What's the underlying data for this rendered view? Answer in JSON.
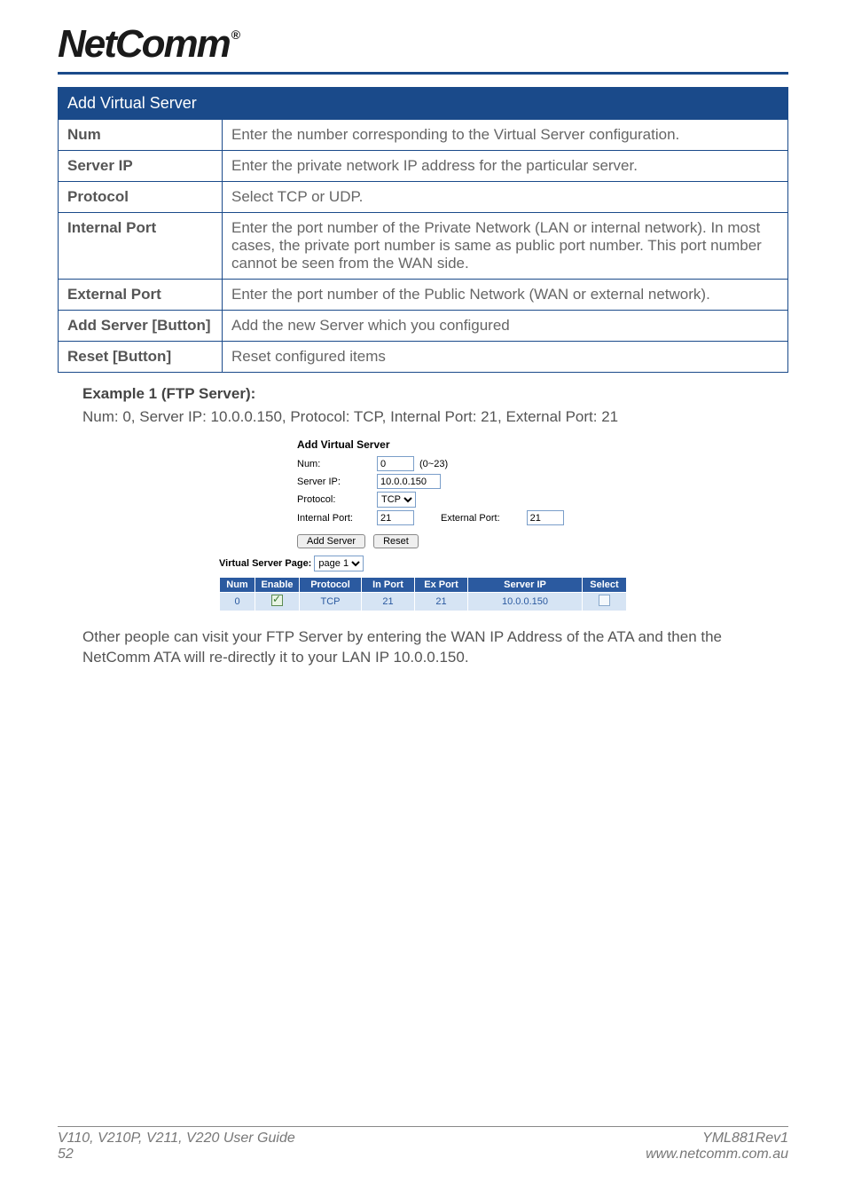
{
  "brand": "NetComm",
  "reg": "®",
  "table": {
    "title": "Add Virtual Server",
    "rows": [
      {
        "label": "Num",
        "desc": "Enter the number corresponding to the Virtual Server configuration."
      },
      {
        "label": "Server IP",
        "desc": "Enter the private network IP address for the particular server."
      },
      {
        "label": "Protocol",
        "desc": "Select TCP or UDP."
      },
      {
        "label": "Internal Port",
        "desc": "Enter the port number of the Private Network (LAN or internal network). In most cases, the private port number is same as public port number. This port number cannot be seen from the WAN side."
      },
      {
        "label": "External Port",
        "desc": "Enter the port number of the Public Network (WAN or external network)."
      },
      {
        "label": "Add Server [Button]",
        "desc": "Add the new Server which you configured"
      },
      {
        "label": "Reset [Button]",
        "desc": "Reset configured items"
      }
    ]
  },
  "example": {
    "title": "Example 1 (FTP Server):",
    "line": "Num: 0, Server IP: 10.0.0.150, Protocol: TCP, Internal Port: 21, External Port: 21"
  },
  "screenshot": {
    "heading": "Add Virtual Server",
    "labels": {
      "num": "Num:",
      "serverip": "Server IP:",
      "protocol": "Protocol:",
      "internalport": "Internal Port:",
      "externalport": "External Port:"
    },
    "values": {
      "num": "0",
      "num_hint": "(0~23)",
      "serverip": "10.0.0.150",
      "protocol": "TCP",
      "internalport": "21",
      "externalport": "21"
    },
    "buttons": {
      "add": "Add Server",
      "reset": "Reset"
    },
    "page_label": "Virtual Server Page:",
    "page_value": "page 1",
    "headers": [
      "Num",
      "Enable",
      "Protocol",
      "In Port",
      "Ex Port",
      "Server IP",
      "Select"
    ],
    "row": {
      "num": "0",
      "enable": true,
      "protocol": "TCP",
      "inport": "21",
      "export": "21",
      "serverip": "10.0.0.150",
      "select": false
    }
  },
  "aftertext": "Other people can visit your FTP Server by entering the WAN IP Address of the ATA and then the NetComm ATA will re-directly it to your LAN IP 10.0.0.150.",
  "footer": {
    "left_title": "V110, V210P, V211, V220 User Guide",
    "left_page": "52",
    "right_code": "YML881Rev1",
    "right_url": "www.netcomm.com.au"
  }
}
